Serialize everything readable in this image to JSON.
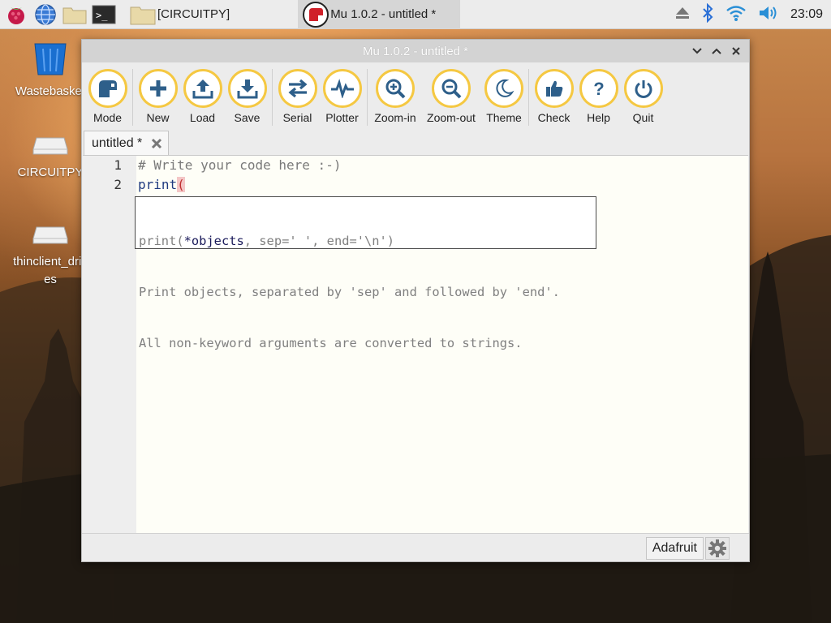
{
  "taskbar": {
    "tasks": [
      {
        "label": "[CIRCUITPY]",
        "icon": "folder-icon"
      },
      {
        "label": "Mu 1.0.2 - untitled *",
        "icon": "mu-icon"
      }
    ],
    "clock": "23:09"
  },
  "desktop": {
    "icons": [
      {
        "label": "Wastebasket",
        "icon": "trash-icon"
      },
      {
        "label": "CIRCUITPY",
        "icon": "drive-icon"
      },
      {
        "label": "thinclient_drives",
        "icon": "drive-icon"
      }
    ]
  },
  "window": {
    "title": "Mu 1.0.2 - untitled *",
    "toolbar": {
      "mode": "Mode",
      "new": "New",
      "load": "Load",
      "save": "Save",
      "serial": "Serial",
      "plotter": "Plotter",
      "zoom_in": "Zoom-in",
      "zoom_out": "Zoom-out",
      "theme": "Theme",
      "check": "Check",
      "help": "Help",
      "quit": "Quit"
    },
    "tab": {
      "label": "untitled *"
    },
    "editor": {
      "line_numbers": [
        "1",
        "2"
      ],
      "line1": "# Write your code here :-)",
      "line2_fn": "print",
      "line2_paren": "("
    },
    "calltip": {
      "sig_pre": "print(",
      "sig_hl": "*objects",
      "sig_post": ", sep=' ', end='\\n')",
      "line2": "Print objects, separated by 'sep' and followed by 'end'.",
      "line3": "All non-keyword arguments are converted to strings."
    },
    "status": {
      "mode": "Adafruit"
    }
  },
  "colors": {
    "toolbar_ring": "#f5c842",
    "icon_blue": "#2e5f8a",
    "editor_bg": "#fefef7"
  }
}
